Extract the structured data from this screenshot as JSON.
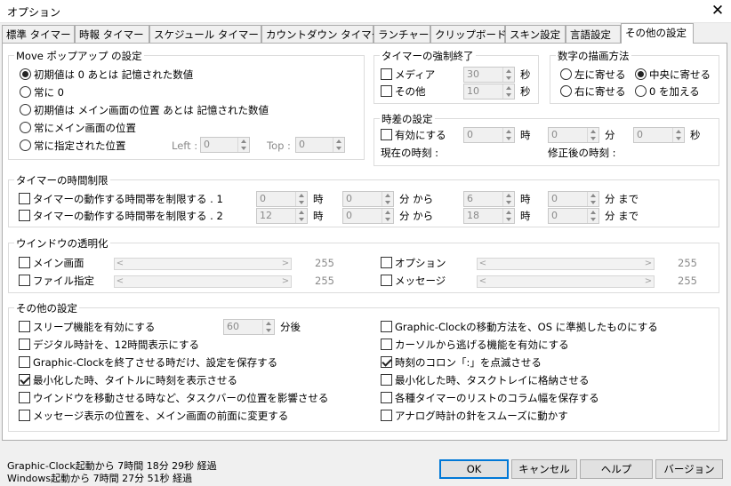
{
  "window": {
    "title": "オプション",
    "close_symbol": "✕"
  },
  "tabs": [
    "標準 タイマー",
    "時報 タイマー",
    "スケジュール タイマー",
    "カウントダウン タイマー",
    "ランチャー",
    "クリップボード",
    "スキン設定",
    "言語設定",
    "その他の設定"
  ],
  "active_tab": 8,
  "move_popup": {
    "title": "Move ポップアップ の設定",
    "options": [
      "初期値は 0 あとは 記憶された数値",
      "常に 0",
      "初期値は メイン画面の位置 あとは 記憶された数値",
      "常にメイン画面の位置",
      "常に指定された位置"
    ],
    "selected": 0,
    "left_label": "Left :",
    "left_value": "0",
    "top_label": "Top :",
    "top_value": "0"
  },
  "force_end": {
    "title": "タイマーの強制終了",
    "media_label": "メディア",
    "media_value": "30",
    "media_checked": false,
    "other_label": "その他",
    "other_value": "10",
    "other_checked": false,
    "unit": "秒"
  },
  "digits": {
    "title": "数字の描画方法",
    "options": [
      "左に寄せる",
      "中央に寄せる",
      "右に寄せる",
      "0 を加える"
    ],
    "selected": 1
  },
  "timediff": {
    "title": "時差の設定",
    "enable_label": "有効にする",
    "enabled": false,
    "hour_value": "0",
    "hour_unit": "時",
    "min_value": "0",
    "min_unit": "分",
    "sec_value": "0",
    "sec_unit": "秒",
    "current_label": "現在の時刻 :",
    "corrected_label": "修正後の時刻 :"
  },
  "time_limit": {
    "title": "タイマーの時間制限",
    "rows": [
      {
        "label": "タイマーの動作する時間帯を制限する . 1",
        "checked": false,
        "h1": "0",
        "m1": "0",
        "h2": "6",
        "m2": "0"
      },
      {
        "label": "タイマーの動作する時間帯を制限する . 2",
        "checked": false,
        "h1": "12",
        "m1": "0",
        "h2": "18",
        "m2": "0"
      }
    ],
    "hour_unit": "時",
    "from_unit": "分 から",
    "to_unit": "分 まで"
  },
  "transparency": {
    "title": "ウインドウの透明化",
    "items": [
      {
        "label": "メイン画面",
        "value": "255",
        "checked": false
      },
      {
        "label": "ファイル指定",
        "value": "255",
        "checked": false
      },
      {
        "label": "オプション",
        "value": "255",
        "checked": false
      },
      {
        "label": "メッセージ",
        "value": "255",
        "checked": false
      }
    ],
    "left_arrow": "<",
    "right_arrow": ">"
  },
  "other": {
    "title": "その他の設定",
    "sleep_value": "60",
    "sleep_unit": "分後",
    "left": [
      {
        "label": "スリープ機能を有効にする",
        "checked": false
      },
      {
        "label": "デジタル時計を、12時間表示にする",
        "checked": false
      },
      {
        "label": "Graphic-Clockを終了させる時だけ、設定を保存する",
        "checked": false
      },
      {
        "label": "最小化した時、タイトルに時刻を表示させる",
        "checked": true
      },
      {
        "label": "ウインドウを移動させる時など、タスクバーの位置を影響させる",
        "checked": false
      },
      {
        "label": "メッセージ表示の位置を、メイン画面の前面に変更する",
        "checked": false
      }
    ],
    "right": [
      {
        "label": "Graphic-Clockの移動方法を、OS に準拠したものにする",
        "checked": false
      },
      {
        "label": "カーソルから逃げる機能を有効にする",
        "checked": false
      },
      {
        "label": "時刻のコロン「:」を点滅させる",
        "checked": true
      },
      {
        "label": "最小化した時、タスクトレイに格納させる",
        "checked": false
      },
      {
        "label": "各種タイマーのリストのコラム幅を保存する",
        "checked": false
      },
      {
        "label": "アナログ時計の針をスムーズに動かす",
        "checked": false
      }
    ]
  },
  "status": {
    "line1": "Graphic-Clock起動から 7時間 18分 29秒 経過",
    "line2": "Windows起動から 7時間 27分 51秒 経過"
  },
  "buttons": {
    "ok": "OK",
    "cancel": "キャンセル",
    "help": "ヘルプ",
    "version": "バージョン"
  }
}
